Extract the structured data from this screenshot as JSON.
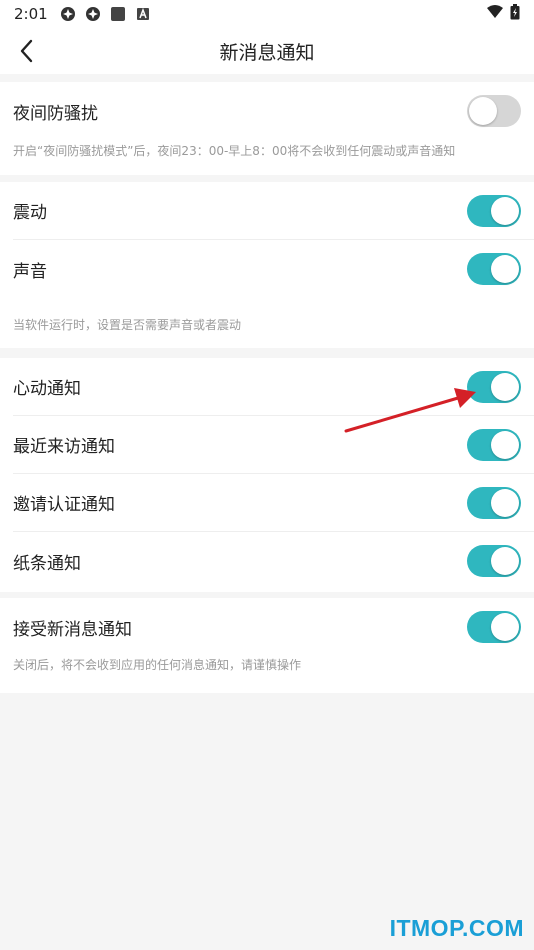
{
  "status_bar": {
    "time": "2:01",
    "icons": [
      "app-notification-icon",
      "app-notification-icon",
      "square-icon",
      "a-badge-icon"
    ],
    "right_icons": [
      "wifi-icon",
      "battery-icon"
    ]
  },
  "header": {
    "title": "新消息通知",
    "back_icon": "chevron-left-icon"
  },
  "colors": {
    "toggle_on": "#2fb7bf",
    "toggle_off": "#d6d6d6",
    "arrow": "#d42027",
    "watermark": "#1a9fd6"
  },
  "section1": {
    "item": {
      "label": "夜间防骚扰",
      "enabled": false
    },
    "hint": "开启“夜间防骚扰模式”后，夜间23：00-早上8：00将不会收到任何震动或声音通知"
  },
  "section2": {
    "items": [
      {
        "label": "震动",
        "enabled": true
      },
      {
        "label": "声音",
        "enabled": true
      }
    ],
    "hint": "当软件运行时，设置是否需要声音或者震动"
  },
  "section3": {
    "items": [
      {
        "label": "心动通知",
        "enabled": true
      },
      {
        "label": "最近来访通知",
        "enabled": true
      },
      {
        "label": "邀请认证通知",
        "enabled": true
      },
      {
        "label": "纸条通知",
        "enabled": true
      }
    ]
  },
  "section4": {
    "item": {
      "label": "接受新消息通知",
      "enabled": true
    },
    "hint": "关闭后，将不会收到应用的任何消息通知，请谨慎操作"
  },
  "watermark": "ITMOP.COM"
}
